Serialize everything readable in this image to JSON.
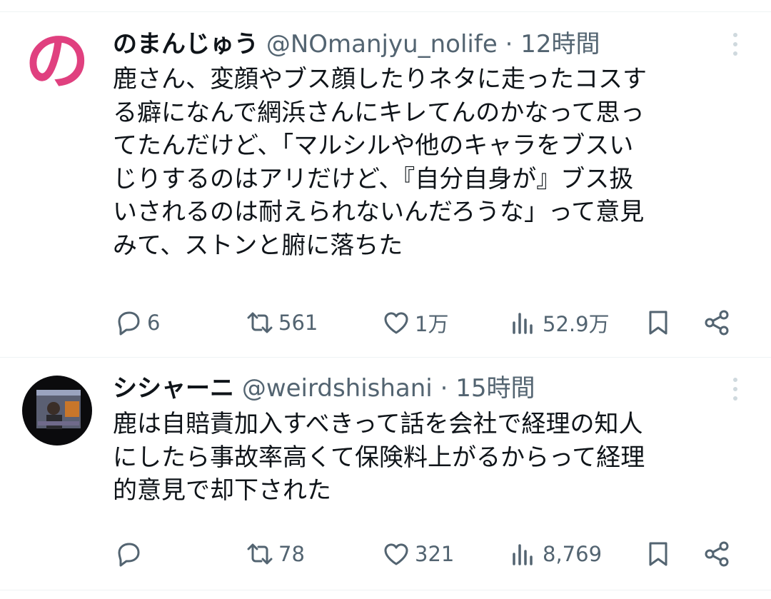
{
  "tweets": [
    {
      "name": "のまんじゅう",
      "handle": "@NOmanjyu_nolife",
      "separator": "·",
      "time": "12時間",
      "avatar_text": "の",
      "body_lines": [
        "鹿さん、変顔やブス顔したりネタに走ったコスす",
        "る癖になんで網浜さんにキレてんのかなって思っ",
        "てたんだけど、「マルシルや他のキャラをブスい",
        "じりするのはアリだけど、『自分自身が』ブス扱",
        "いされるのは耐えられないんだろうな」って意見",
        "みて、ストンと腑に落ちた"
      ],
      "replies": "6",
      "retweets": "561",
      "likes": "1万",
      "views": "52.9万"
    },
    {
      "name": "シシャーニ",
      "handle": "@weirdshishani",
      "separator": "·",
      "time": "15時間",
      "body_lines": [
        "鹿は自賠責加入すべきって話を会社で経理の知人",
        "にしたら事故率高くて保険料上がるからって経理",
        "的意見で却下された"
      ],
      "replies": "",
      "retweets": "78",
      "likes": "321",
      "views": "8,769"
    }
  ],
  "colors": {
    "text": "#0f1419",
    "secondary": "#536471",
    "divider": "#eff3f4",
    "avatar_logo": "#e0407f"
  },
  "icons": [
    "reply-icon",
    "retweet-icon",
    "like-icon",
    "views-icon",
    "bookmark-icon",
    "share-icon",
    "more-icon"
  ]
}
